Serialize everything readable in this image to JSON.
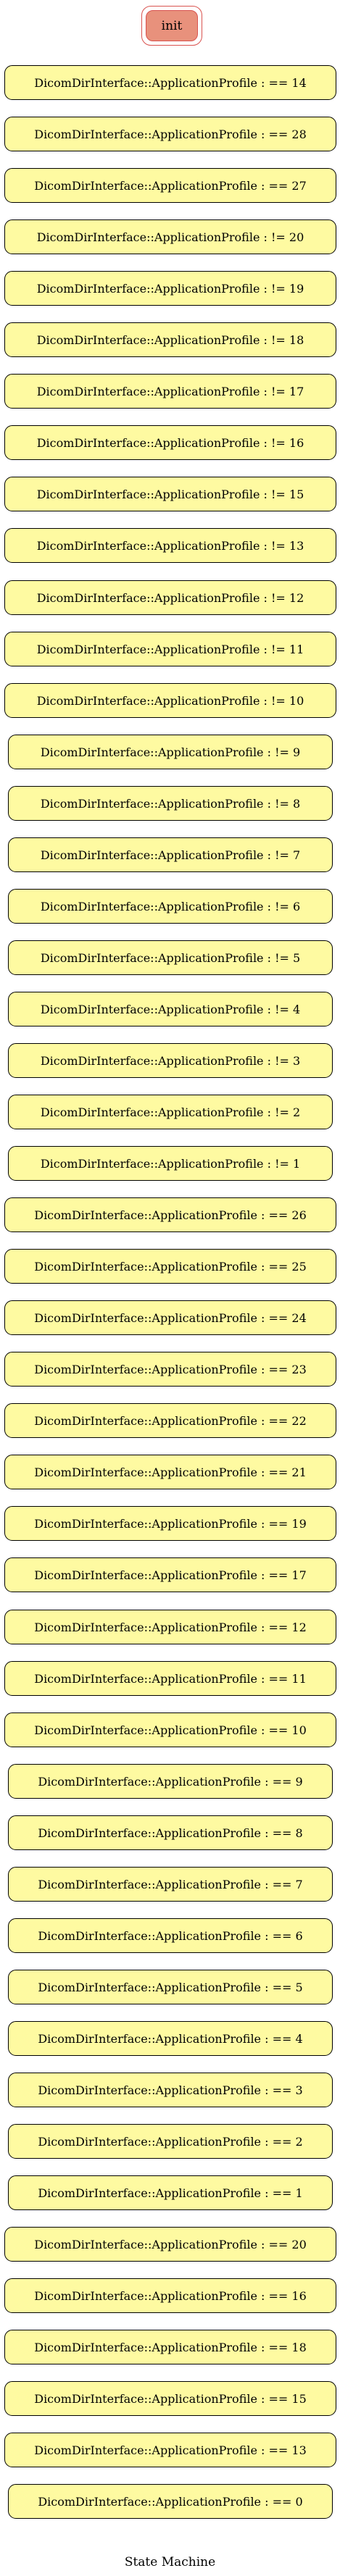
{
  "diagram": {
    "initial_state": "init",
    "caption": "State Machine",
    "states": [
      "DicomDirInterface::ApplicationProfile : == 14",
      "DicomDirInterface::ApplicationProfile : == 28",
      "DicomDirInterface::ApplicationProfile : == 27",
      "DicomDirInterface::ApplicationProfile : != 20",
      "DicomDirInterface::ApplicationProfile : != 19",
      "DicomDirInterface::ApplicationProfile : != 18",
      "DicomDirInterface::ApplicationProfile : != 17",
      "DicomDirInterface::ApplicationProfile : != 16",
      "DicomDirInterface::ApplicationProfile : != 15",
      "DicomDirInterface::ApplicationProfile : != 13",
      "DicomDirInterface::ApplicationProfile : != 12",
      "DicomDirInterface::ApplicationProfile : != 11",
      "DicomDirInterface::ApplicationProfile : != 10",
      "DicomDirInterface::ApplicationProfile : != 9",
      "DicomDirInterface::ApplicationProfile : != 8",
      "DicomDirInterface::ApplicationProfile : != 7",
      "DicomDirInterface::ApplicationProfile : != 6",
      "DicomDirInterface::ApplicationProfile : != 5",
      "DicomDirInterface::ApplicationProfile : != 4",
      "DicomDirInterface::ApplicationProfile : != 3",
      "DicomDirInterface::ApplicationProfile : != 2",
      "DicomDirInterface::ApplicationProfile : != 1",
      "DicomDirInterface::ApplicationProfile : == 26",
      "DicomDirInterface::ApplicationProfile : == 25",
      "DicomDirInterface::ApplicationProfile : == 24",
      "DicomDirInterface::ApplicationProfile : == 23",
      "DicomDirInterface::ApplicationProfile : == 22",
      "DicomDirInterface::ApplicationProfile : == 21",
      "DicomDirInterface::ApplicationProfile : == 19",
      "DicomDirInterface::ApplicationProfile : == 17",
      "DicomDirInterface::ApplicationProfile : == 12",
      "DicomDirInterface::ApplicationProfile : == 11",
      "DicomDirInterface::ApplicationProfile : == 10",
      "DicomDirInterface::ApplicationProfile : == 9",
      "DicomDirInterface::ApplicationProfile : == 8",
      "DicomDirInterface::ApplicationProfile : == 7",
      "DicomDirInterface::ApplicationProfile : == 6",
      "DicomDirInterface::ApplicationProfile : == 5",
      "DicomDirInterface::ApplicationProfile : == 4",
      "DicomDirInterface::ApplicationProfile : == 3",
      "DicomDirInterface::ApplicationProfile : == 2",
      "DicomDirInterface::ApplicationProfile : == 1",
      "DicomDirInterface::ApplicationProfile : == 20",
      "DicomDirInterface::ApplicationProfile : == 16",
      "DicomDirInterface::ApplicationProfile : == 18",
      "DicomDirInterface::ApplicationProfile : == 15",
      "DicomDirInterface::ApplicationProfile : == 13",
      "DicomDirInterface::ApplicationProfile : == 0"
    ],
    "colors": {
      "state_fill": "#fefaa1",
      "state_border": "#000000",
      "init_fill": "#e8917c",
      "init_border": "#d9534f"
    }
  }
}
